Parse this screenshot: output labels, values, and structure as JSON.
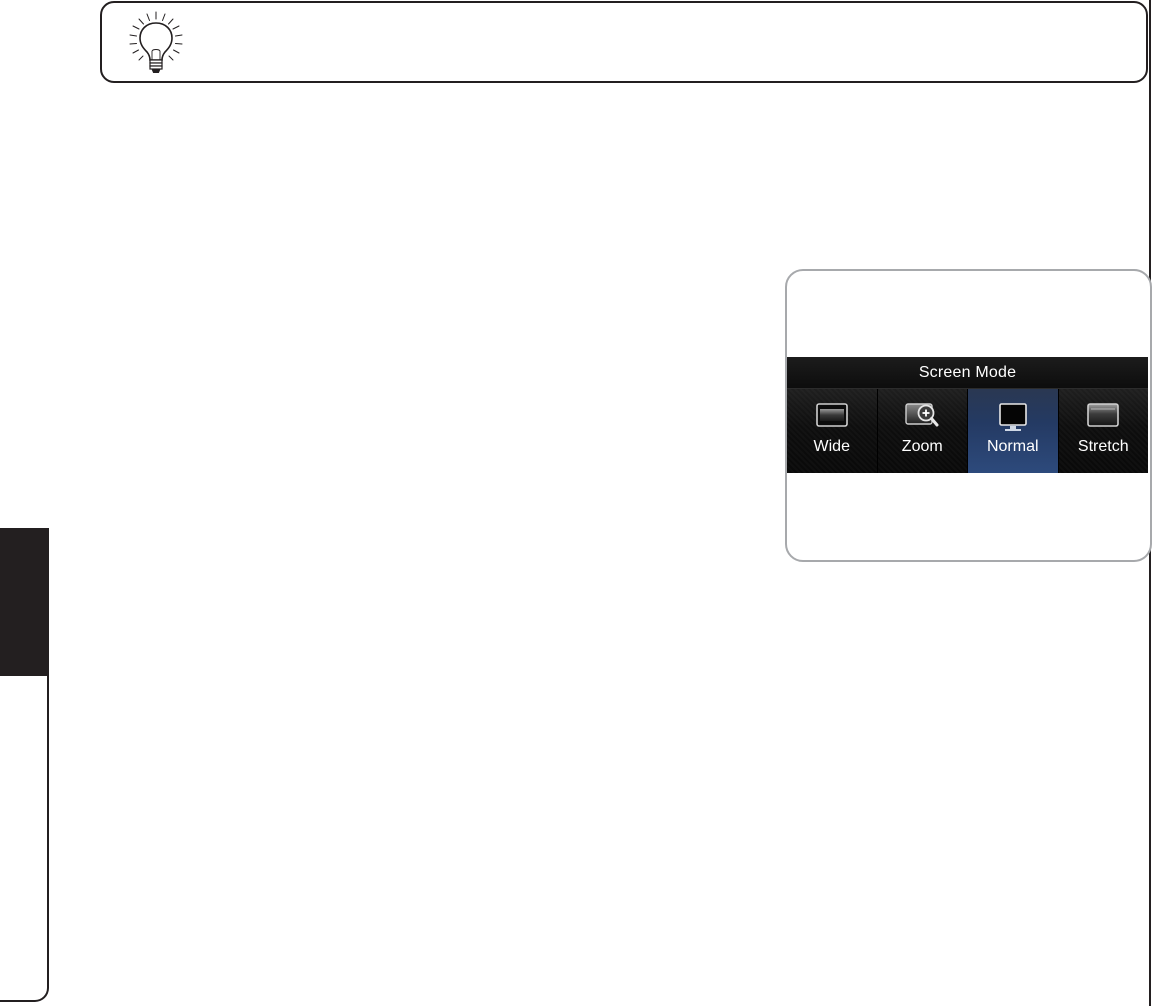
{
  "tip": {
    "icon": "lightbulb-icon"
  },
  "screen_mode": {
    "title": "Screen Mode",
    "options": [
      {
        "label": "Wide",
        "icon": "screen-wide-icon",
        "selected": false
      },
      {
        "label": "Zoom",
        "icon": "screen-zoom-icon",
        "selected": false
      },
      {
        "label": "Normal",
        "icon": "screen-normal-icon",
        "selected": true
      },
      {
        "label": "Stretch",
        "icon": "screen-stretch-icon",
        "selected": false
      }
    ]
  },
  "colors": {
    "ink": "#231f20",
    "frame": "#a7a9ac",
    "osd_background": "#0a0a0a",
    "selected_background": "#2d4a7c"
  }
}
